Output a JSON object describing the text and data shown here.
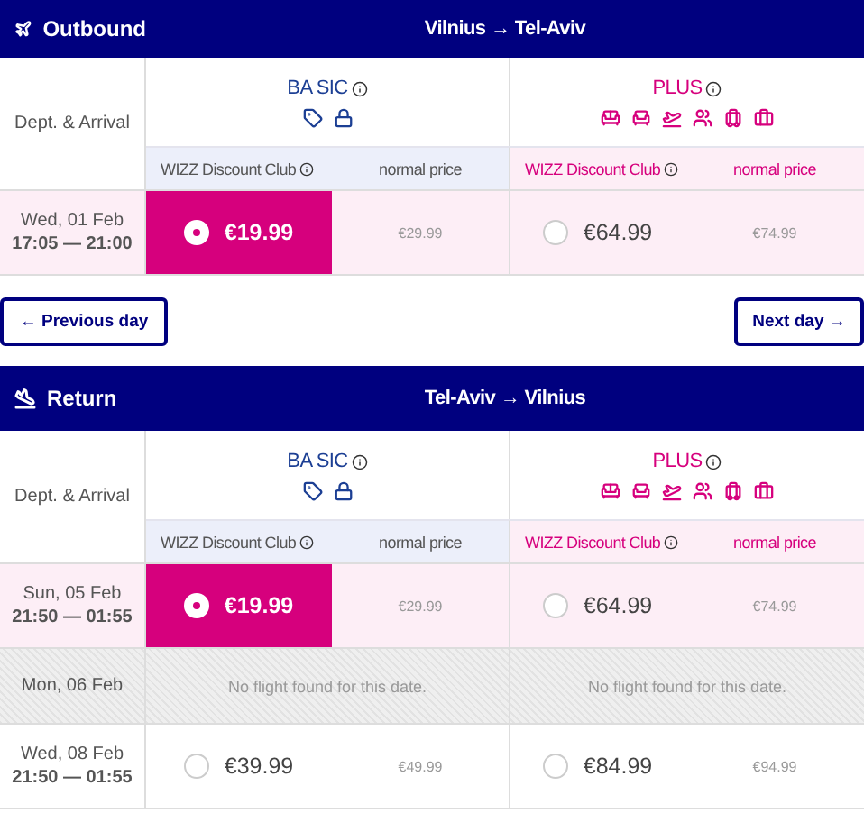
{
  "sections": [
    {
      "kind": "outbound",
      "title": "Outbound",
      "route": "Vilnius → Tel-Aviv",
      "times_label": "Dept. & Arrival",
      "fares": [
        {
          "kind": "basic",
          "name": "BA SIC",
          "club_label": "WIZZ Discount Club",
          "normal_label": "normal price"
        },
        {
          "kind": "plus",
          "name": "PLUS",
          "club_label": "WIZZ Discount Club",
          "normal_label": "normal price"
        }
      ],
      "rows": [
        {
          "date": "Wed, 01 Feb",
          "time": "17:05 — 21:00",
          "available": true,
          "highlighted": true,
          "prices": [
            {
              "club": "€19.99",
              "normal": "€29.99",
              "selected": true
            },
            {
              "club": "€64.99",
              "normal": "€74.99",
              "selected": false
            }
          ]
        }
      ]
    },
    {
      "kind": "return",
      "title": "Return",
      "route": "Tel-Aviv → Vilnius",
      "times_label": "Dept. & Arrival",
      "fares": [
        {
          "kind": "basic",
          "name": "BA SIC",
          "club_label": "WIZZ Discount Club",
          "normal_label": "normal price"
        },
        {
          "kind": "plus",
          "name": "PLUS",
          "club_label": "WIZZ Discount Club",
          "normal_label": "normal price"
        }
      ],
      "rows": [
        {
          "date": "Sun, 05 Feb",
          "time": "21:50 — 01:55",
          "available": true,
          "highlighted": true,
          "prices": [
            {
              "club": "€19.99",
              "normal": "€29.99",
              "selected": true
            },
            {
              "club": "€64.99",
              "normal": "€74.99",
              "selected": false
            }
          ]
        },
        {
          "date": "Mon, 06 Feb",
          "available": false,
          "highlighted": false,
          "messages": [
            "No flight found for this date.",
            "No flight found for this date."
          ]
        },
        {
          "date": "Wed, 08 Feb",
          "time": "21:50 — 01:55",
          "available": true,
          "highlighted": false,
          "prices": [
            {
              "club": "€39.99",
              "normal": "€49.99",
              "selected": false
            },
            {
              "club": "€84.99",
              "normal": "€94.99",
              "selected": false
            }
          ]
        }
      ]
    }
  ],
  "navigation": {
    "previous": "← Previous day",
    "next": "Next day →"
  }
}
